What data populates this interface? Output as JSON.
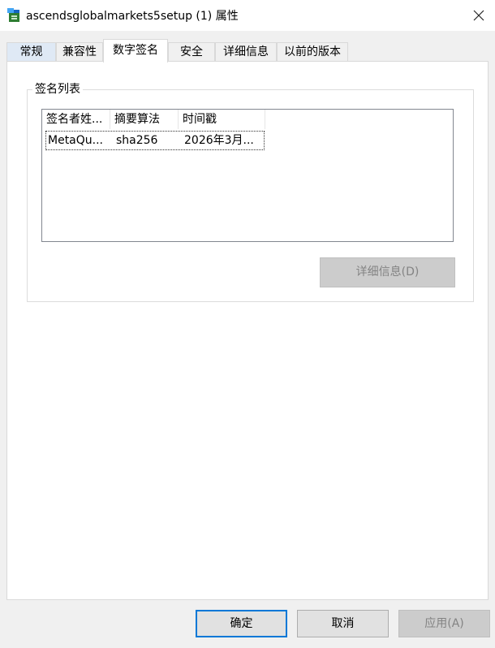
{
  "window": {
    "title": "ascendsglobalmarkets5setup (1) 属性"
  },
  "tabs": [
    {
      "label": "常规"
    },
    {
      "label": "兼容性"
    },
    {
      "label": "数字签名"
    },
    {
      "label": "安全"
    },
    {
      "label": "详细信息"
    },
    {
      "label": "以前的版本"
    }
  ],
  "active_tab": "数字签名",
  "signature_group": {
    "label": "签名列表",
    "columns": [
      "签名者姓...",
      "摘要算法",
      "时间戳"
    ],
    "rows": [
      {
        "signer": "MetaQu...",
        "digest": "sha256",
        "timestamp": "2026年3月..."
      }
    ],
    "details_button": "详细信息(D)"
  },
  "footer": {
    "ok": "确定",
    "cancel": "取消",
    "apply": "应用(A)"
  },
  "colors": {
    "accent": "#0078d7",
    "disabled_text": "#838383",
    "panel_bg": "#ffffff",
    "dialog_bg": "#f0f0f0"
  },
  "icons": {
    "app": "installer-icon",
    "close": "close-icon"
  }
}
